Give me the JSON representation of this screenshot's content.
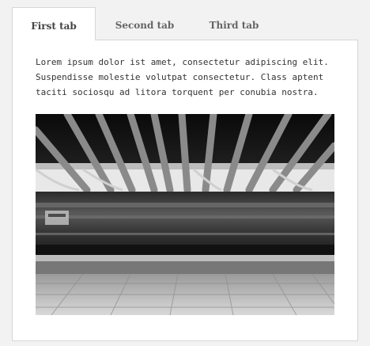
{
  "tabs": [
    {
      "label": "First tab",
      "active": true
    },
    {
      "label": "Second tab",
      "active": false
    },
    {
      "label": "Third tab",
      "active": false
    }
  ],
  "panel": {
    "text": "Lorem ipsum dolor ist amet, consectetur adipiscing elit.\nSuspendisse molestie volutpat consectetur. Class aptent\ntaciti sociosqu ad litora torquent per conubia nostra.",
    "image_description_icon": "train-station-photo"
  },
  "colors": {
    "background": "#f2f2f2",
    "panel_bg": "#ffffff",
    "border": "#d6d6d6",
    "tab_text": "#666666",
    "body_text": "#333333"
  }
}
